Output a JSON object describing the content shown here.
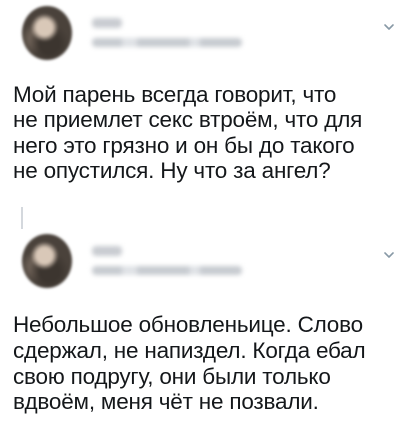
{
  "tweets": [
    {
      "text": "Мой парень всегда говорит, что\nне приемлет секс втроём, что для\nнего это грязно и он бы до такого\nне опустился. Ну что за ангел?"
    },
    {
      "text": "Небольшое обновленьице. Слово\nсдержал, не напиздел. Когда ебал\nсвою подругу, они были только\nвдвоём, меня чёт не позвали."
    }
  ],
  "icons": {
    "menu": "chevron-down-icon"
  },
  "colors": {
    "text": "#14171a",
    "chevron": "#8899a6",
    "thread_line": "#d4d8dd"
  }
}
